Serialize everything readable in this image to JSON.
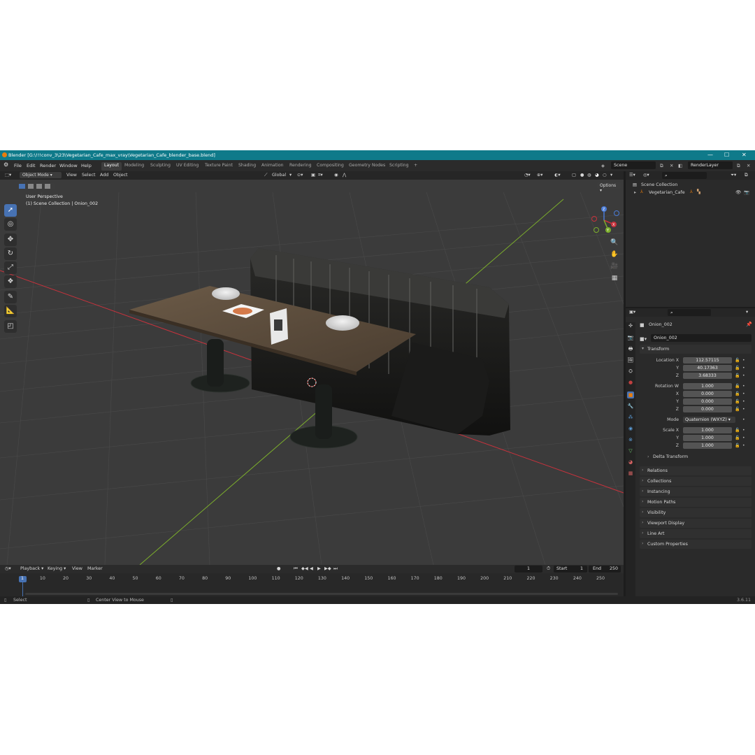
{
  "window": {
    "title": "Blender [G:\\!!!conv_3\\23\\Vegetarian_Cafe_max_vray\\Vegetarian_Cafe_blender_base.blend]",
    "minimize": "—",
    "maximize": "☐",
    "close": "✕"
  },
  "menu": {
    "items": [
      "File",
      "Edit",
      "Render",
      "Window",
      "Help"
    ],
    "workspaces": [
      "Layout",
      "Modeling",
      "Sculpting",
      "UV Editing",
      "Texture Paint",
      "Shading",
      "Animation",
      "Rendering",
      "Compositing",
      "Geometry Nodes",
      "Scripting"
    ],
    "add_workspace": "+",
    "scene": "Scene",
    "view_layer": "RenderLayer"
  },
  "viewport": {
    "mode": "Object Mode",
    "menus": [
      "View",
      "Select",
      "Add",
      "Object"
    ],
    "transform_orientation": "Global",
    "options_label": "Options",
    "overlay_line1": "User Perspective",
    "overlay_line2": "(1) Scene Collection | Onion_002",
    "gizmo": {
      "x": "X",
      "y": "Y",
      "z": "Z"
    }
  },
  "tools": [
    "select-box",
    "cursor",
    "move",
    "rotate",
    "scale",
    "transform",
    "annotate",
    "measure",
    "add-cube"
  ],
  "outliner": {
    "root": "Scene Collection",
    "items": [
      {
        "name": "Vegetarian_Cafe"
      }
    ]
  },
  "properties": {
    "object_name": "Onion_002",
    "data_name": "Onion_002",
    "transform_label": "Transform",
    "location": {
      "label": "Location X",
      "x": "112.57115",
      "y": "40.17363",
      "z": "3.68333"
    },
    "rotation": {
      "label": "Rotation W",
      "w": "1.000",
      "x": "0.000",
      "y": "0.000",
      "z": "0.000"
    },
    "mode_label": "Mode",
    "mode_value": "Quaternion (WXYZ)",
    "scale": {
      "label": "Scale X",
      "x": "1.000",
      "y": "1.000",
      "z": "1.000"
    },
    "axis_labels": {
      "y": "Y",
      "z": "Z",
      "x": "X"
    },
    "delta_transform": "Delta Transform",
    "panels": [
      "Relations",
      "Collections",
      "Instancing",
      "Motion Paths",
      "Visibility",
      "Viewport Display",
      "Line Art",
      "Custom Properties"
    ]
  },
  "timeline": {
    "menus": [
      "Playback",
      "Keying",
      "View",
      "Marker"
    ],
    "current_frame": "1",
    "start_label": "Start",
    "start": "1",
    "end_label": "End",
    "end": "250",
    "ticks": [
      "1",
      "10",
      "20",
      "30",
      "40",
      "50",
      "60",
      "70",
      "80",
      "90",
      "100",
      "110",
      "120",
      "130",
      "140",
      "150",
      "160",
      "170",
      "180",
      "190",
      "200",
      "210",
      "220",
      "230",
      "240",
      "250"
    ]
  },
  "status": {
    "left": "Select",
    "middle": "Center View to Mouse",
    "version": "3.6.11"
  },
  "colors": {
    "accent": "#4772b3",
    "titlebar": "#0f7a8a",
    "x_axis": "#c8323c",
    "y_axis": "#7cae2c",
    "orange": "#e87d0d"
  }
}
